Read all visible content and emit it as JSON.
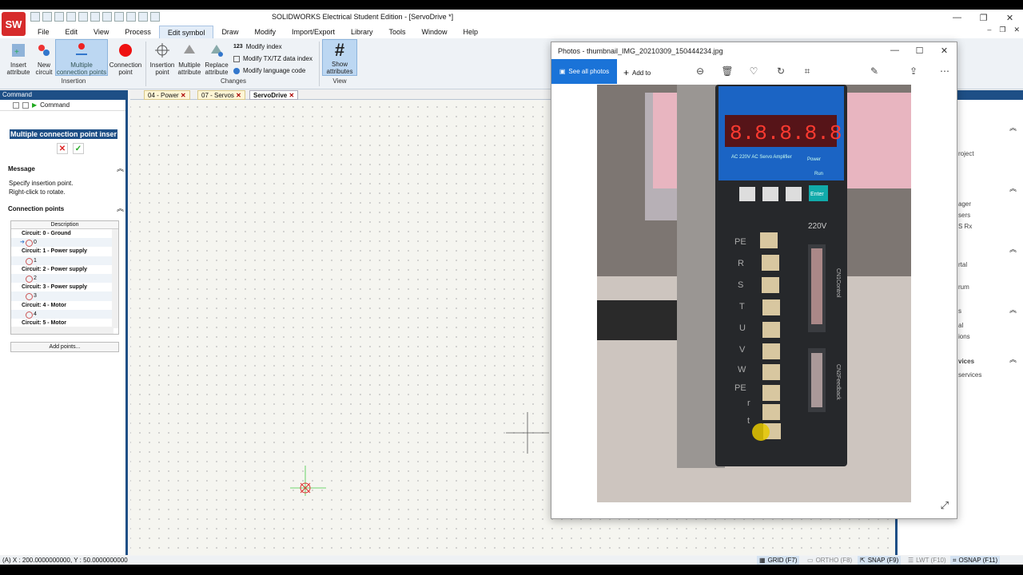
{
  "app": {
    "title": "SOLIDWORKS Electrical Student Edition - [ServoDrive *]",
    "logo_text": "SW",
    "window_controls": [
      "—",
      "❐",
      "✕"
    ],
    "mdi_controls": [
      "–",
      "❐",
      "✕"
    ]
  },
  "menu": [
    "File",
    "Edit",
    "View",
    "Process",
    "Edit symbol",
    "Draw",
    "Modify",
    "Import/Export",
    "Library",
    "Tools",
    "Window",
    "Help"
  ],
  "ribbon": {
    "insert_attribute": "Insert attribute",
    "new_circuit": "New circuit",
    "multiple_connection_points": "Multiple connection points",
    "connection_point": "Connection point",
    "insertion_group": "Insertion",
    "insertion_point": "Insertion point",
    "multiple_attribute": "Multiple attribute",
    "replace_attribute": "Replace attribute",
    "modify_index": "Modify index",
    "modify_index_badge": "123",
    "modify_tx_tz": "Modify TX/TZ data index",
    "modify_language": "Modify language code",
    "changes_group": "Changes",
    "show_attributes": "Show attributes",
    "show_attributes_symbol": "#",
    "view_group": "View"
  },
  "left_panel": {
    "header": "Command",
    "tab_label": "Command",
    "command_title": "Multiple connection point inser",
    "message_heading": "Message",
    "message_lines": [
      "Specify insertion point.",
      "Right-click to rotate."
    ],
    "cp_heading": "Connection points",
    "table_header": "Description",
    "rows": [
      {
        "circuit": "Circuit: 0 - Ground",
        "point": "0"
      },
      {
        "circuit": "Circuit: 1 - Power supply",
        "point": "1"
      },
      {
        "circuit": "Circuit: 2 - Power supply",
        "point": "2"
      },
      {
        "circuit": "Circuit: 3 - Power supply",
        "point": "3"
      },
      {
        "circuit": "Circuit: 4 - Motor",
        "point": "4"
      },
      {
        "circuit": "Circuit: 5 - Motor",
        "point": ""
      }
    ],
    "add_points": "Add points..."
  },
  "doc_tabs": [
    "04 - Power",
    "07 - Servos",
    "ServoDrive"
  ],
  "right_panel": {
    "items": [
      "roject",
      "ager",
      "sers",
      "S Rx",
      "rtal",
      "rum",
      "s",
      "al",
      "ions",
      "vices",
      "services"
    ]
  },
  "photos": {
    "title": "Photos - thumbnail_IMG_20210309_150444234.jpg",
    "see_all": "See all photos",
    "add_to": "Add to",
    "more": "⋯",
    "drive_voltage": "220V",
    "drive_label": "AC 220V  AC Servo Amplifier",
    "led_power": "Power",
    "led_run": "Run",
    "terminals": [
      "PE",
      "R",
      "S",
      "T",
      "U",
      "V",
      "W",
      "PE",
      "r",
      "t"
    ],
    "cn1": "CN1Control",
    "cn2": "CN2Feedback",
    "enter": "Enter",
    "display": "8.8.8.8.8"
  },
  "status": {
    "coords": "(A) X : 200.0000000000, Y : 50.0000000000",
    "grid": "GRID (F7)",
    "ortho": "ORTHO (F8)",
    "snap": "SNAP (F9)",
    "lwt": "LWT (F10)",
    "osnap": "OSNAP (F11)"
  }
}
